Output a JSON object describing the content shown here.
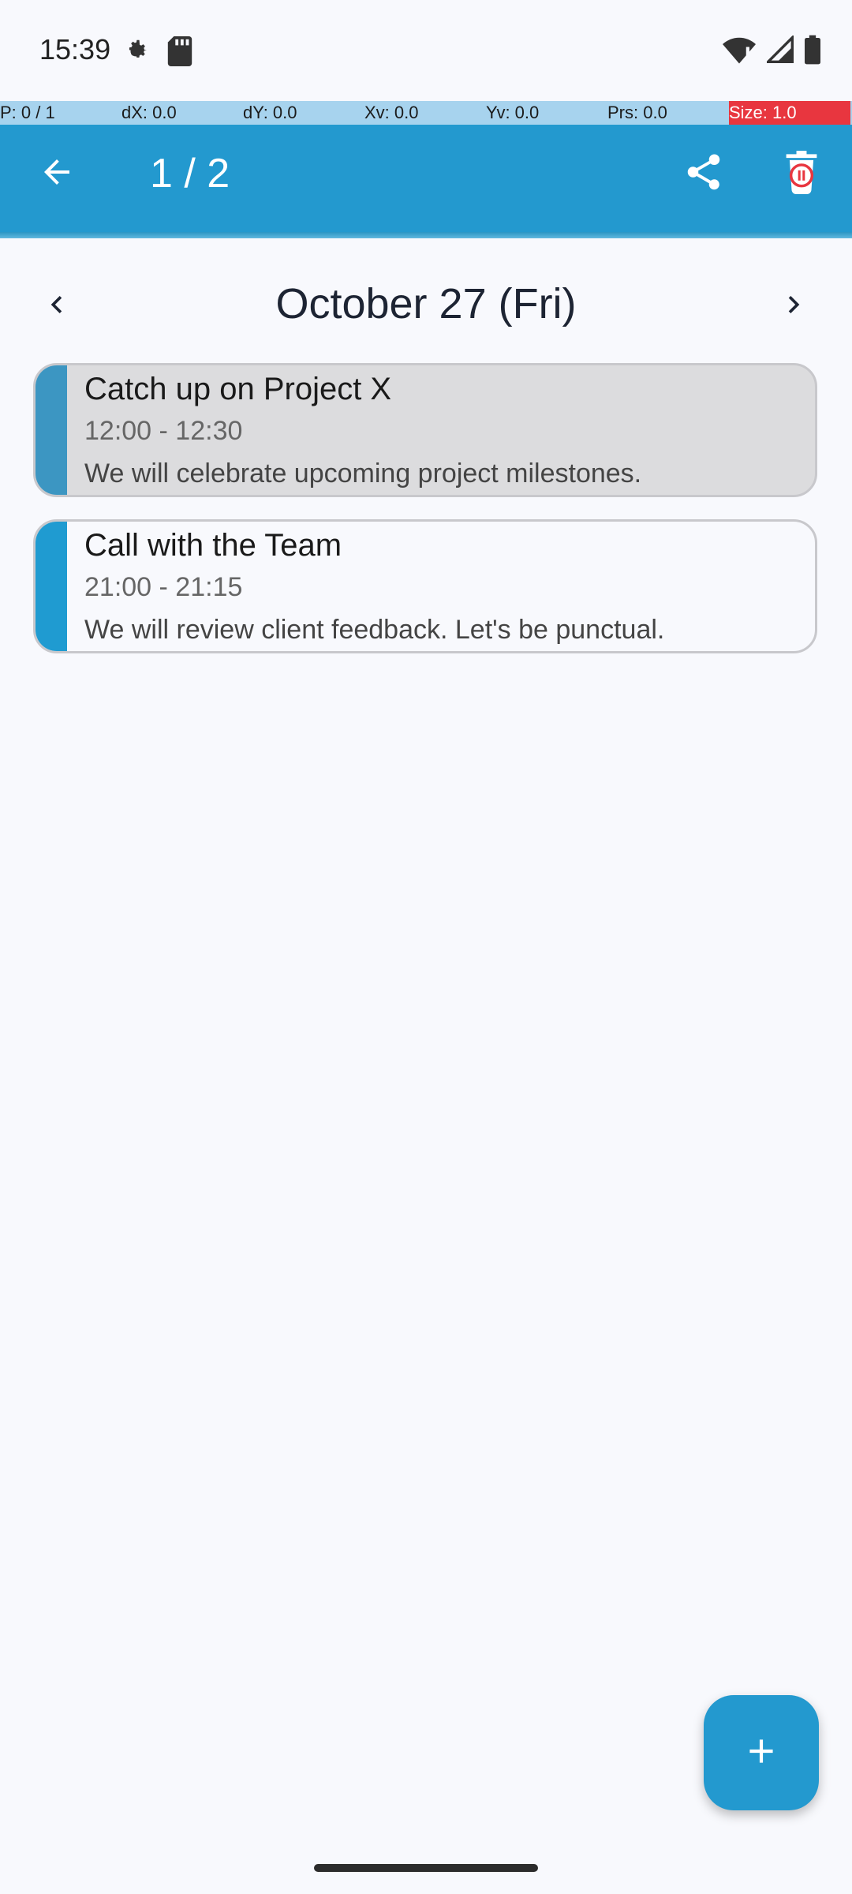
{
  "status_bar": {
    "time": "15:39",
    "icons": [
      "gear-icon",
      "sd-card-icon",
      "wifi-alert-icon",
      "signal-icon",
      "battery-icon"
    ]
  },
  "debug_overlay": {
    "cells": [
      "P: 0 / 1",
      "dX: 0.0",
      "dY: 0.0",
      "Xv: 0.0",
      "Yv: 0.0",
      "Prs: 0.0",
      "Size: 1.0"
    ]
  },
  "app_bar": {
    "page_counter": "1 / 2",
    "color": "#2399cf"
  },
  "date_nav": {
    "title": "October 27 (Fri)"
  },
  "events": [
    {
      "title": "Catch up on Project X",
      "time": "12:00 - 12:30",
      "description": "We will celebrate upcoming project milestones.",
      "stripe_color": "#3c96c2",
      "background": "#dcdcde"
    },
    {
      "title": "Call with the Team",
      "time": "21:00 - 21:15",
      "description": "We will review client feedback. Let's be punctual.",
      "stripe_color": "#1f9bd1",
      "background": "#f8f9fd"
    }
  ],
  "fab": {
    "icon": "plus-icon"
  }
}
